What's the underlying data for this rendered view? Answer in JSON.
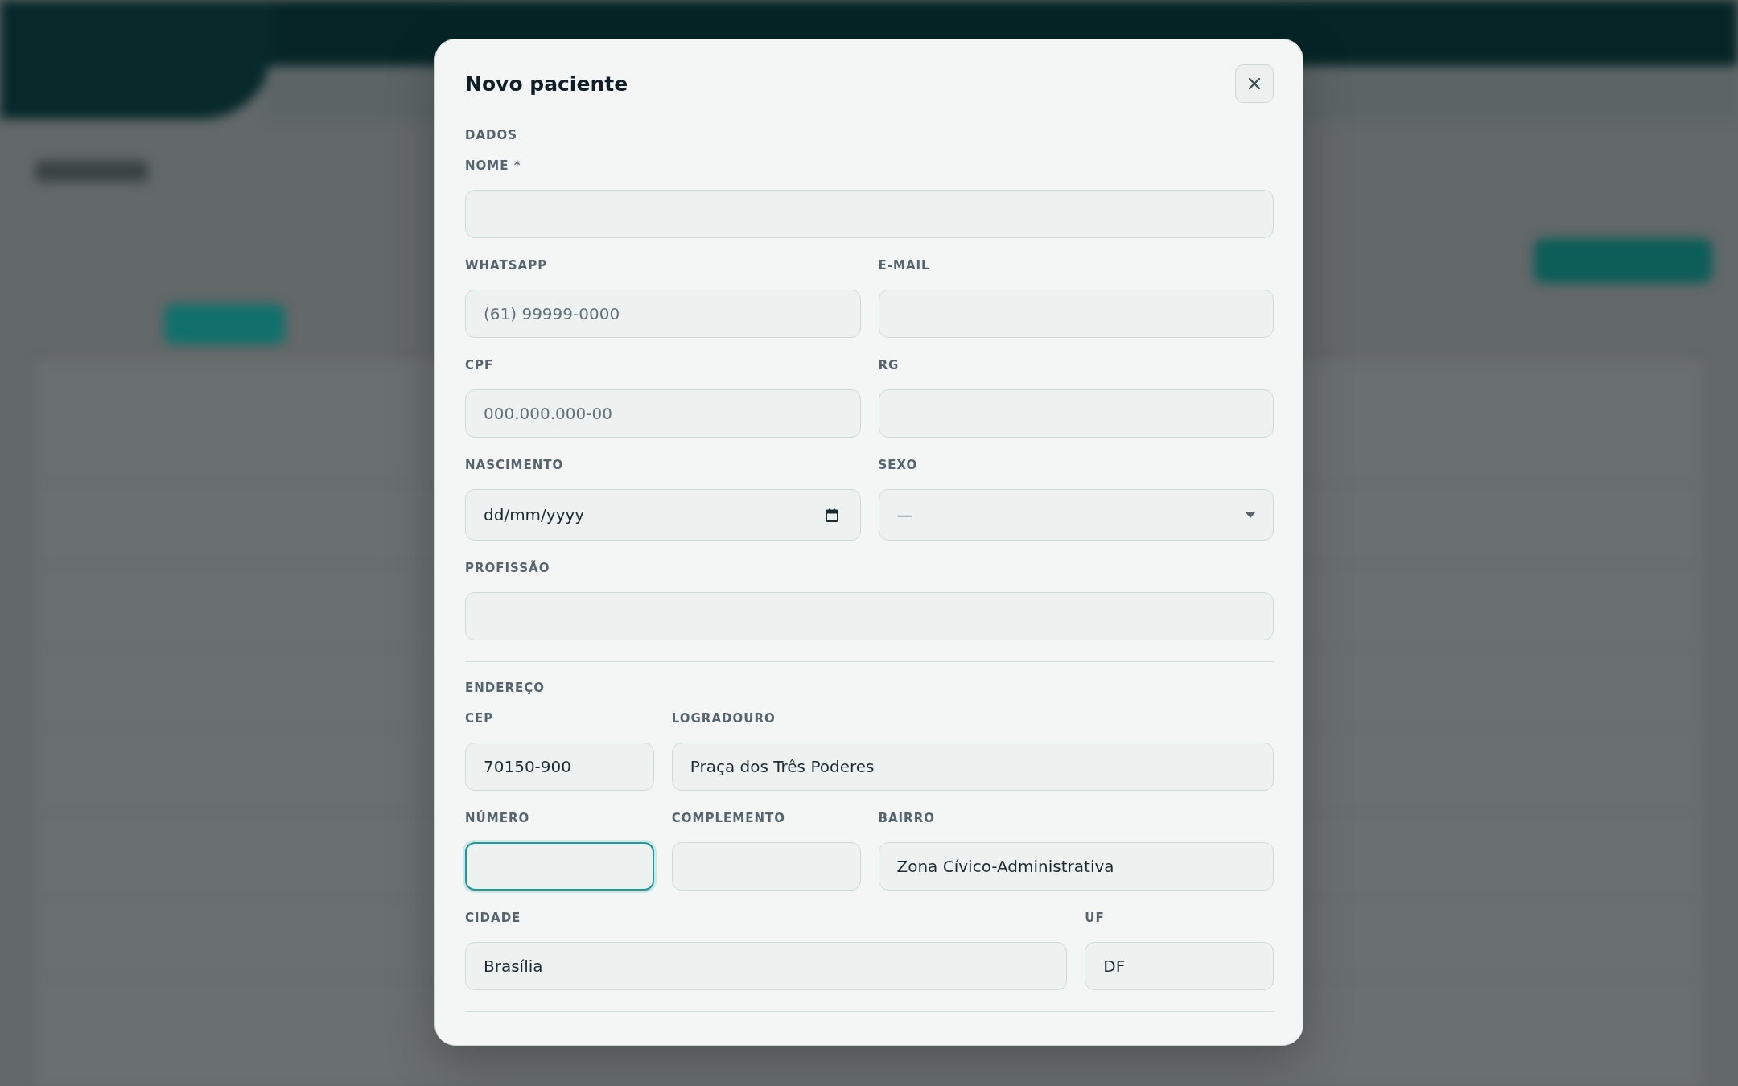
{
  "dialog": {
    "title": "Novo paciente",
    "sections": [
      {
        "heading": "DADOS",
        "fields": [
          {
            "label": "NOME *",
            "kind": "text",
            "focused": false
          },
          {
            "label": "WHATSAPP",
            "kind": "text",
            "placeholder": "(61) 99999-0000",
            "focused": false
          },
          {
            "label": "E-MAIL",
            "kind": "text",
            "focused": false
          },
          {
            "label": "CPF",
            "kind": "text",
            "placeholder": "000.000.000-00",
            "focused": false
          },
          {
            "label": "RG",
            "kind": "text",
            "focused": false
          },
          {
            "label": "NASCIMENTO",
            "kind": "date",
            "placeholder": "dd/mm/yyyy",
            "focused": false
          },
          {
            "label": "SEXO",
            "kind": "select",
            "value": "—",
            "focused": false
          },
          {
            "label": "PROFISSÃO",
            "kind": "text",
            "focused": false
          }
        ]
      },
      {
        "heading": "ENDEREÇO",
        "fields": [
          {
            "label": "CEP",
            "kind": "text",
            "value": "70150-900",
            "focused": false
          },
          {
            "label": "LOGRADOURO",
            "kind": "text",
            "value": "Praça dos Três Poderes",
            "focused": false
          },
          {
            "label": "NÚMERO",
            "kind": "text",
            "focused": true
          },
          {
            "label": "COMPLEMENTO",
            "kind": "text",
            "focused": false
          },
          {
            "label": "BAIRRO",
            "kind": "text",
            "value": "Zona Cívico-Administrativa",
            "focused": false
          },
          {
            "label": "CIDADE",
            "kind": "text",
            "value": "Brasília",
            "focused": false
          },
          {
            "label": "UF",
            "kind": "text",
            "value": "DF",
            "focused": false
          }
        ]
      }
    ]
  }
}
